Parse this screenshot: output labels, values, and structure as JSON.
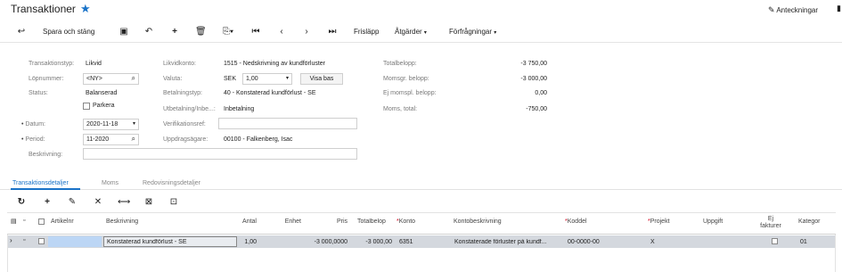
{
  "header": {
    "title": "Transaktioner",
    "notes_label": "Anteckningar"
  },
  "toolbar": {
    "save_close_label": "Spara och stäng",
    "release_label": "Frisläpp",
    "actions_label": "Åtgärder",
    "inquiries_label": "Förfrågningar"
  },
  "form": {
    "col1": {
      "type_label": "Transaktionstyp:",
      "type_value": "Likvid",
      "serial_label": "Löpnummer:",
      "serial_value": "<NY>",
      "status_label": "Status:",
      "status_value": "Balanserad",
      "park_label": "Parkera",
      "date_label": "Datum:",
      "date_value": "2020-11-18",
      "period_label": "Period:",
      "period_value": "11-2020",
      "desc_label": "Beskrivning:",
      "desc_value": ""
    },
    "col2": {
      "account_label": "Likvidkonto:",
      "account_value": "1515 - Nedskrivning av kundförluster",
      "currency_label": "Valuta:",
      "currency_value": "SEK",
      "rate_value": "1,00",
      "show_base_label": "Visa bas",
      "paytype_label": "Betalningstyp:",
      "paytype_value": "40 - Konstaterad kundförlust - SE",
      "outin_label": "Utbetalning/Inbe...:",
      "outin_value": "Inbetalning",
      "verref_label": "Verifikationsref:",
      "verref_value": "",
      "client_label": "Uppdragsägare:",
      "client_value": "00100 - Falkenberg, Isac"
    },
    "col3": {
      "total_label": "Totalbelopp:",
      "total_value": "-3 750,00",
      "vatable_label": "Momsgr. belopp:",
      "vatable_value": "-3 000,00",
      "nonvat_label": "Ej momspl. belopp:",
      "nonvat_value": "0,00",
      "vat_total_label": "Moms, total:",
      "vat_total_value": "-750,00"
    }
  },
  "tabs": [
    "Transaktionsdetaljer",
    "Moms",
    "Redovisningsdetaljer"
  ],
  "grid": {
    "columns": {
      "article": "Artikelnr",
      "desc": "Beskrivning",
      "qty": "Antal",
      "unit": "Enhet",
      "price": "Pris",
      "total": "Totalbelop",
      "account": "Konto",
      "account_desc": "Kontobeskrivning",
      "costcode": "Koddel",
      "project": "Projekt",
      "task": "Uppgift",
      "noninvoiced_1": "Ej",
      "noninvoiced_2": "fakturer",
      "category": "Kategor"
    },
    "rows": [
      {
        "article": "",
        "desc": "Konstaterad kundförlust - SE",
        "qty": "1,00",
        "unit": "",
        "price": "-3 000,0000",
        "total": "-3 000,00",
        "account": "6351",
        "account_desc": "Konstaterade förluster på kundf...",
        "costcode": "00-0000-00",
        "project": "X",
        "task": "",
        "category": "01"
      }
    ]
  },
  "colors": {
    "accent": "#1a73c8",
    "row_selected": "#d4d8de",
    "star": "#1a73c8"
  }
}
